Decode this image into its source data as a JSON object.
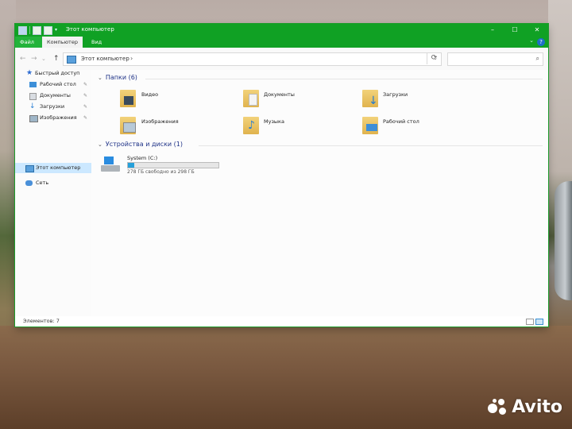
{
  "window": {
    "title": "Этот компьютер",
    "controls": {
      "minimize": "–",
      "maximize": "☐",
      "close": "✕"
    }
  },
  "ribbon": {
    "tabs": [
      "Файл",
      "Компьютер",
      "Вид"
    ]
  },
  "navigation": {
    "back": "←",
    "forward": "→",
    "recent": "⌄",
    "up": "↑",
    "address": "Этот компьютер",
    "search_placeholder": ""
  },
  "sidebar": {
    "quick_access": "Быстрый доступ",
    "pinned": [
      {
        "label": "Рабочий стол",
        "icon": "desktop-icon"
      },
      {
        "label": "Документы",
        "icon": "documents-icon"
      },
      {
        "label": "Загрузки",
        "icon": "downloads-icon"
      },
      {
        "label": "Изображения",
        "icon": "pictures-icon"
      }
    ],
    "this_pc": "Этот компьютер",
    "network": "Сеть"
  },
  "main": {
    "folders_header": "Папки (6)",
    "folders": [
      {
        "label": "Видео",
        "icon": "videos-folder-icon"
      },
      {
        "label": "Документы",
        "icon": "documents-folder-icon"
      },
      {
        "label": "Загрузки",
        "icon": "downloads-folder-icon"
      },
      {
        "label": "Изображения",
        "icon": "pictures-folder-icon"
      },
      {
        "label": "Музыка",
        "icon": "music-folder-icon"
      },
      {
        "label": "Рабочий стол",
        "icon": "desktop-folder-icon"
      }
    ],
    "devices_header": "Устройства и диски (1)",
    "drive": {
      "name": "System (C:)",
      "free_text": "278 ГБ свободно из 298 ГБ",
      "used_fraction": 0.067
    }
  },
  "status": {
    "items": "Элементов: 7"
  },
  "watermark": "Avito",
  "colors": {
    "titlebar": "#10a124",
    "accent": "#26a0da",
    "selection": "#cce8ff"
  }
}
